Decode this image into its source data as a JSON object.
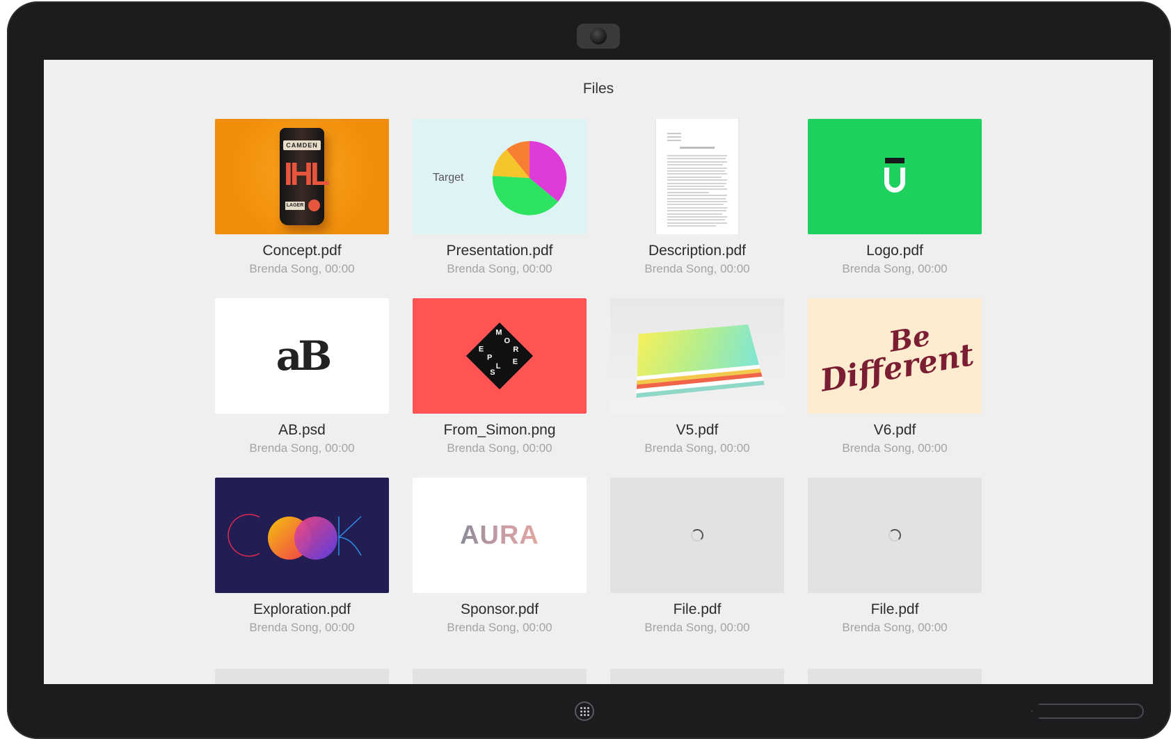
{
  "screen": {
    "title": "Files"
  },
  "files": [
    {
      "name": "Concept.pdf",
      "meta": "Brenda Song, 00:00",
      "thumb": "orange-beer-can"
    },
    {
      "name": "Presentation.pdf",
      "meta": "Brenda Song, 00:00",
      "thumb": "pie-chart",
      "thumb_text": "Target"
    },
    {
      "name": "Description.pdf",
      "meta": "Brenda Song, 00:00",
      "thumb": "text-document"
    },
    {
      "name": "Logo.pdf",
      "meta": "Brenda Song, 00:00",
      "thumb": "green-u-logo"
    },
    {
      "name": "AB.psd",
      "meta": "Brenda Song, 00:00",
      "thumb": "ab-monogram",
      "thumb_text": "aB"
    },
    {
      "name": "From_Simon.png",
      "meta": "Brenda Song, 00:00",
      "thumb": "black-diamond-on-red",
      "thumb_text": "M O R E E P L S"
    },
    {
      "name": "V5.pdf",
      "meta": "Brenda Song, 00:00",
      "thumb": "gradient-books"
    },
    {
      "name": "V6.pdf",
      "meta": "Brenda Song, 00:00",
      "thumb": "be-different-lettering",
      "thumb_text_1": "Be",
      "thumb_text_2": "Different"
    },
    {
      "name": "Exploration.pdf",
      "meta": "Brenda Song, 00:00",
      "thumb": "cook-circles"
    },
    {
      "name": "Sponsor.pdf",
      "meta": "Brenda Song, 00:00",
      "thumb": "aura-wordmark",
      "thumb_text": "AURA"
    },
    {
      "name": "File.pdf",
      "meta": "Brenda Song, 00:00",
      "thumb": "loading-spinner"
    },
    {
      "name": "File.pdf",
      "meta": "Brenda Song, 00:00",
      "thumb": "loading-spinner"
    }
  ],
  "colors": {
    "screen_bg": "#efefef",
    "device_bezel": "#1c1c1e",
    "concept_orange": "#f7961a",
    "presentation_bg": "#dff3f7",
    "logo_green": "#1ed15f",
    "simon_red": "#fe5454",
    "v6_cream": "#fdeccf",
    "exploration_navy": "#221d52",
    "pie_magenta": "#de3bd8",
    "pie_green": "#2ee35f",
    "pie_yellow": "#f6c52c",
    "pie_orange": "#f77f32"
  },
  "device": {
    "camera": "camera-icon",
    "home_button": "apps-grid-icon",
    "stylus": "stylus-icon"
  }
}
